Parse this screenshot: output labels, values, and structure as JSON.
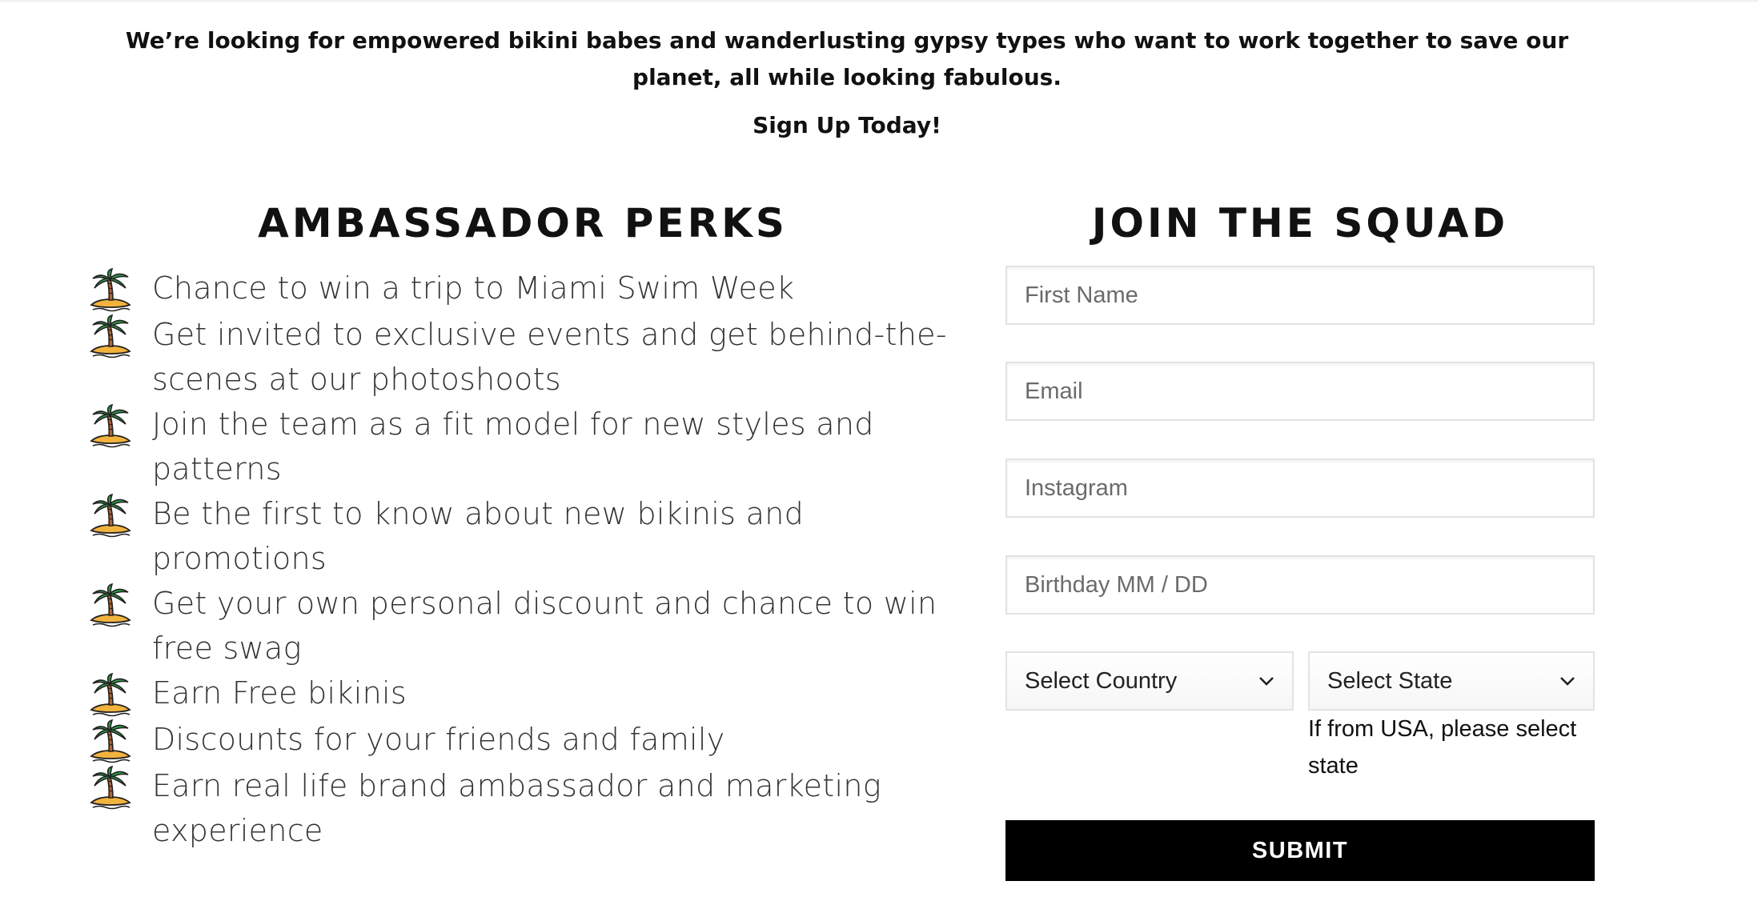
{
  "intro": {
    "text": "We’re looking for empowered bikini babes and wanderlusting gypsy types who want to work together to save our planet, all while looking fabulous.",
    "cta": "Sign Up Today!"
  },
  "perks": {
    "title": "AMBASSADOR PERKS",
    "icon": "palm-tree-island-icon",
    "items": [
      "Chance to win a trip to Miami Swim Week",
      "Get invited to exclusive events and get behind-the-scenes at our photoshoots",
      "Join the team as a fit model for new styles and patterns",
      "Be the first to know about new bikinis and promotions",
      "Get your own personal discount and chance to win free swag",
      "Earn Free bikinis",
      "Discounts for your friends and family",
      "Earn real life brand ambassador and marketing experience"
    ]
  },
  "form": {
    "title": "JOIN THE SQUAD",
    "first_name_placeholder": "First Name",
    "email_placeholder": "Email",
    "instagram_placeholder": "Instagram",
    "birthday_placeholder": "Birthday MM / DD",
    "country_select": "Select Country",
    "state_select": "Select State",
    "state_hint": "If from USA, please select state",
    "submit_label": "SUBMIT"
  },
  "colors": {
    "text": "#111111",
    "perk_text": "#333333",
    "button_bg": "#000000",
    "button_text": "#ffffff",
    "field_border": "#e3e3e3"
  }
}
